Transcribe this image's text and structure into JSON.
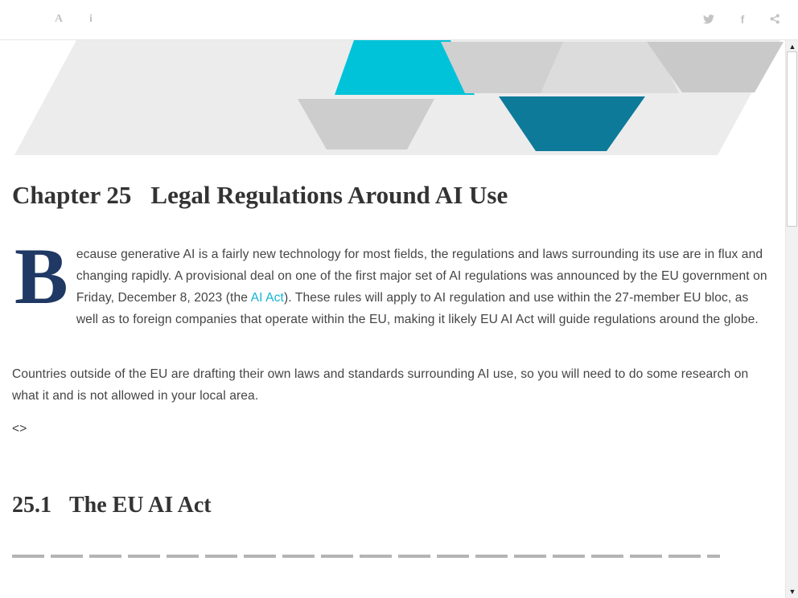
{
  "toolbar": {
    "font_icon": "A",
    "info_icon": "i",
    "twitter_icon": "twitter-icon",
    "facebook_icon": "f",
    "share_icon": "share-icon"
  },
  "chapter": {
    "number": "Chapter 25",
    "title": "Legal Regulations Around AI Use"
  },
  "paragraph1": {
    "dropcap": "B",
    "before_link": "ecause generative AI is a fairly new technology for most fields, the regulations and laws surrounding its use are in flux and changing rapidly. A provisional deal on one of the first major set of AI regulations was announced by the EU government on Friday, December 8, 2023 (the ",
    "link": "AI Act",
    "after_link": "). These rules will apply to AI regulation and use within the 27-member EU bloc, as well as to foreign companies that operate within the EU, making it likely EU AI Act will guide regulations around the globe."
  },
  "paragraph2": "Countries outside of the EU are drafting their own laws and standards surrounding AI use, so you will need to do some research on what it and is not allowed in your local area.",
  "paragraph3": "<>",
  "section": {
    "number": "25.1",
    "title": "The EU AI Act"
  },
  "colors": {
    "cyan": "#00c3d9",
    "teal": "#0e7a9a",
    "gray": "#cfcfcf",
    "light_gray": "#ececec",
    "dropcap": "#1f3864",
    "link": "#12b5d6"
  }
}
